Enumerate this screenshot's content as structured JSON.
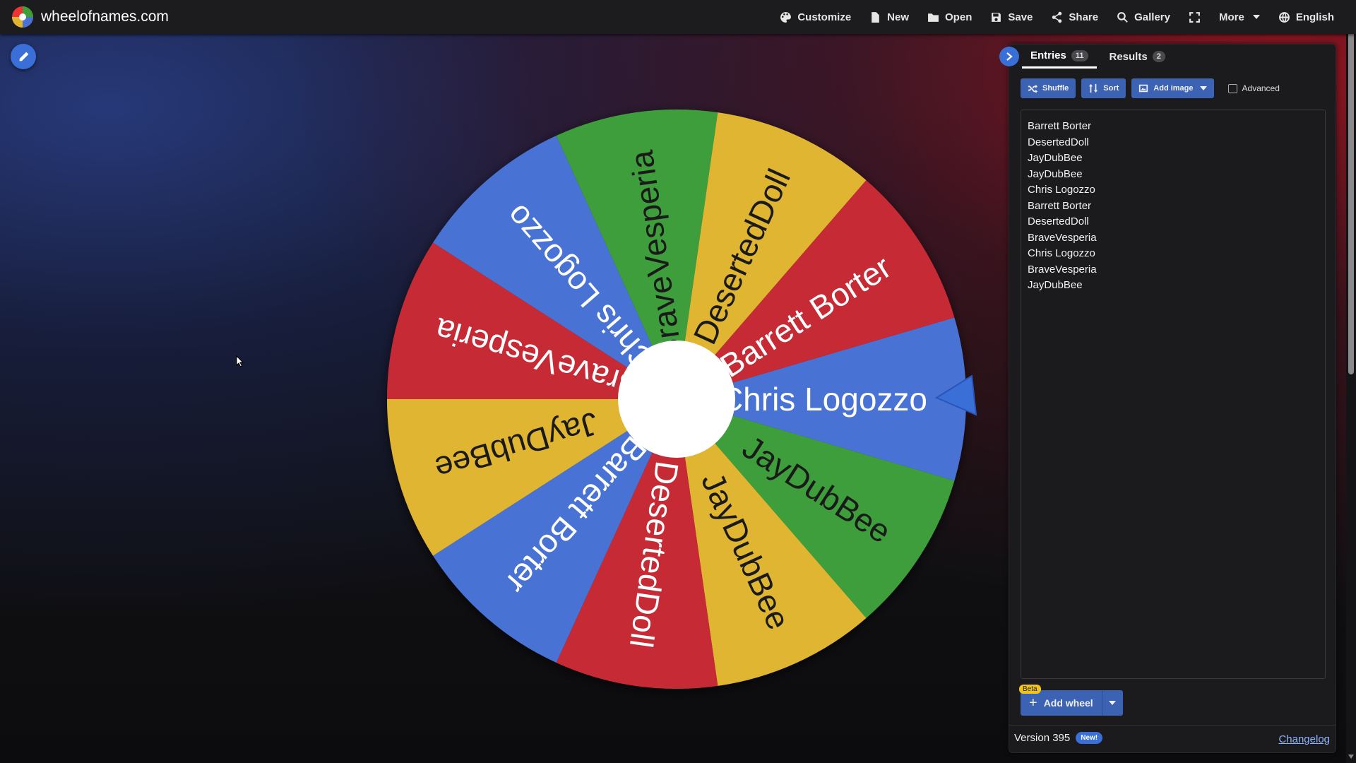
{
  "site": {
    "name": "wheelofnames.com",
    "logo_icon": "wheel-logo-icon"
  },
  "nav": {
    "items": [
      {
        "label": "Customize",
        "icon": "palette-icon"
      },
      {
        "label": "New",
        "icon": "file-icon"
      },
      {
        "label": "Open",
        "icon": "folder-icon"
      },
      {
        "label": "Save",
        "icon": "save-icon"
      },
      {
        "label": "Share",
        "icon": "share-icon"
      },
      {
        "label": "Gallery",
        "icon": "search-icon"
      },
      {
        "label": "",
        "icon": "fullscreen-icon"
      },
      {
        "label": "More",
        "icon": "chevron-down-icon"
      },
      {
        "label": "English",
        "icon": "globe-icon"
      }
    ]
  },
  "wheel": {
    "pointer_color": "#3a6fd8",
    "hub_color": "#ffffff",
    "colors": {
      "green": "#3e9e3a",
      "yellow": "#e0b532",
      "red": "#c62a36",
      "blue": "#4a72d5"
    },
    "segments": [
      {
        "label": "Chris Logozzo",
        "color": "blue"
      },
      {
        "label": "JayDubBee",
        "color": "green"
      },
      {
        "label": "JayDubBee",
        "color": "yellow"
      },
      {
        "label": "DesertedDoll",
        "color": "red"
      },
      {
        "label": "Barrett Borter",
        "color": "blue"
      },
      {
        "label": "JayDubBee",
        "color": "yellow"
      },
      {
        "label": "BraveVesperia",
        "color": "red"
      },
      {
        "label": "Chris Logozzo",
        "color": "blue"
      },
      {
        "label": "BraveVesperia",
        "color": "green"
      },
      {
        "label": "DesertedDoll",
        "color": "yellow"
      },
      {
        "label": "Barrett Borter",
        "color": "red"
      }
    ]
  },
  "panel": {
    "tabs": [
      {
        "label": "Entries",
        "count": "11"
      },
      {
        "label": "Results",
        "count": "2"
      }
    ],
    "toolbar": {
      "shuffle": "Shuffle",
      "sort": "Sort",
      "add_image": "Add image",
      "advanced": "Advanced"
    },
    "entries": [
      "Barrett Borter",
      "DesertedDoll",
      "JayDubBee",
      "JayDubBee",
      "Chris Logozzo",
      "Barrett Borter",
      "DesertedDoll",
      "BraveVesperia",
      "Chris Logozzo",
      "BraveVesperia",
      "JayDubBee"
    ],
    "add_wheel": {
      "badge": "Beta",
      "label": "Add wheel"
    },
    "footer": {
      "version": "Version 395",
      "new_badge": "New!",
      "changelog": "Changelog"
    }
  }
}
